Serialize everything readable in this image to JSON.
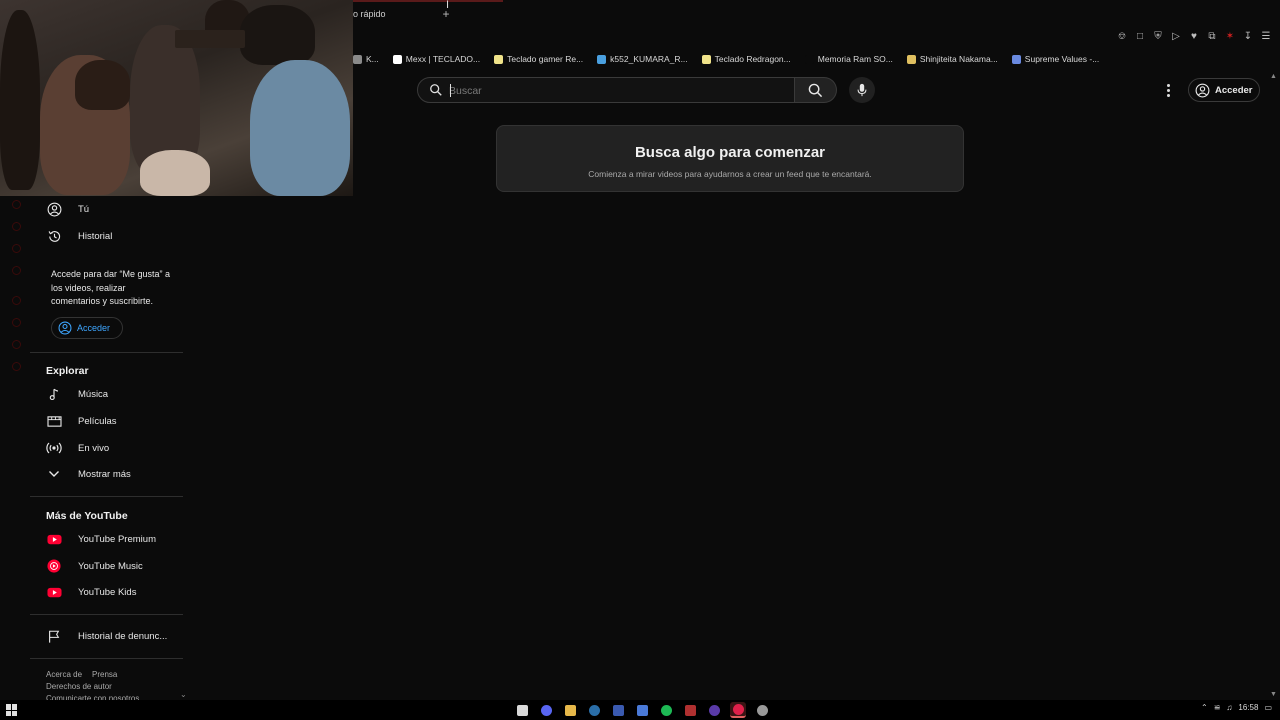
{
  "browser": {
    "tab_title": "o rápido",
    "new_tab": "+",
    "bookmarks": [
      {
        "label": "K...",
        "color": "#8a8a8a"
      },
      {
        "label": "Mexx | TECLADO...",
        "color": "#ffffff"
      },
      {
        "label": "Teclado gamer Re...",
        "color": "#f0e38a"
      },
      {
        "label": "k552_KUMARA_R...",
        "color": "#4aa0e0"
      },
      {
        "label": "Teclado Redragon...",
        "color": "#f0e38a"
      },
      {
        "label": "Memoria Ram SO...",
        "color": "#0b0b0b"
      },
      {
        "label": "Shinjiteita Nakama...",
        "color": "#e0c060"
      },
      {
        "label": "Supreme Values -...",
        "color": "#6a8ae0"
      }
    ]
  },
  "header": {
    "search_placeholder": "Buscar",
    "signin_label": "Acceder"
  },
  "empty_state": {
    "title": "Busca algo para comenzar",
    "subtitle": "Comienza a mirar videos para ayudarnos a crear un feed que te encantará."
  },
  "sidebar": {
    "you_label": "Tú",
    "history_label": "Historial",
    "signin_note": "Accede para dar “Me gusta” a los videos, realizar comentarios y suscribirte.",
    "signin_label": "Acceder",
    "explore_title": "Explorar",
    "explore_items": [
      "Música",
      "Películas",
      "En vivo",
      "Mostrar más"
    ],
    "more_title": "Más de YouTube",
    "more_items": [
      "YouTube Premium",
      "YouTube Music",
      "YouTube Kids"
    ],
    "report_history": "Historial de denunc...",
    "footer": {
      "about": "Acerca de",
      "press": "Prensa",
      "copyright": "Derechos de autor",
      "contact": "Comunicarte con nosotros"
    }
  },
  "taskbar": {
    "time": "16:58"
  },
  "colors": {
    "accent_red": "#ff0000",
    "link_blue": "#3ea6ff",
    "background": "#0b0b0b"
  }
}
